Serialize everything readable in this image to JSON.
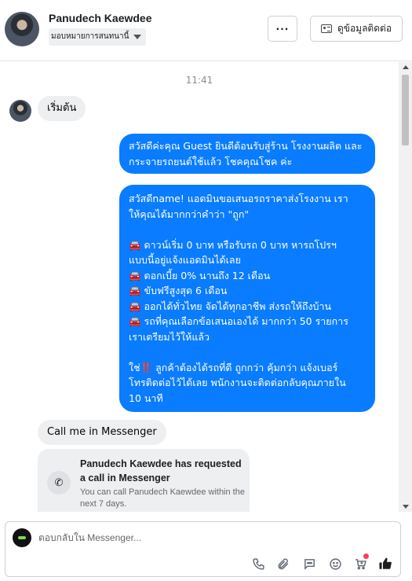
{
  "header": {
    "contact_name": "Panudech Kaewdee",
    "assign_label": "มอบหมายการสนทนานี้",
    "more_label": "···",
    "contact_info_label": "ดูข้อมูลติดต่อ"
  },
  "chat": {
    "timestamp": "11:41",
    "start_label": "เริ่มต้น",
    "greeting": "สวัสดีค่ะคุณ Guest ยินดีต้อนรับสู่ร้าน โรงงานผลิต และกระจายรถยนต์ใช้แล้ว โชคคุณโชค ค่ะ",
    "offer_lines": [
      "สวัสดีname! แอดมินขอเสนอรถราคาส่งโรงงาน เรา",
      "ให้คุณได้มากกว่าคำว่า \"ถูก\"",
      "",
      "🚘 ดาวน์เริ่ม 0 บาท หรือรับรถ 0 บาท หารถโปรฯ",
      "แบบนี้อยู่แจ้งแอดมินได้เลย",
      "🚘 ดอกเบี้ย 0% นานถึง 12 เดือน",
      "🚘 ขับฟรีสูงสุด 6 เดือน",
      "🚘 ออกได้ทั่วไทย จัดได้ทุกอาชีพ ส่งรถให้ถึงบ้าน",
      "🚘 รถที่คุณเลือกข้อเสนอเองได้ มากกว่า 50 รายการ",
      "เราเตรียมไว้ให้แล้ว",
      "",
      "ใช่‼️ ลูกค้าต้องได้รถที่ดี ถูกกว่า คุ้มกว่า แจ้งเบอร์",
      "โทรติดต่อไว้ได้เลย พนักงานจะติดต่อกลับคุณภายใน",
      "10 นาที"
    ],
    "call_me_label": "Call me in Messenger",
    "call_card": {
      "title": "Panudech Kaewdee has requested a call in Messenger",
      "subtitle": "You can call Panudech Kaewdee within the next 7 days."
    }
  },
  "composer": {
    "placeholder": "ตอบกลับใน Messenger...",
    "icons": [
      "phone-icon",
      "paperclip-icon",
      "chat-icon",
      "emoji-icon",
      "cart-icon",
      "like-icon"
    ]
  },
  "colors": {
    "accent": "#0a7cff",
    "bubble_gray": "#eeeff1",
    "notification_dot": "#fa3e5a"
  }
}
